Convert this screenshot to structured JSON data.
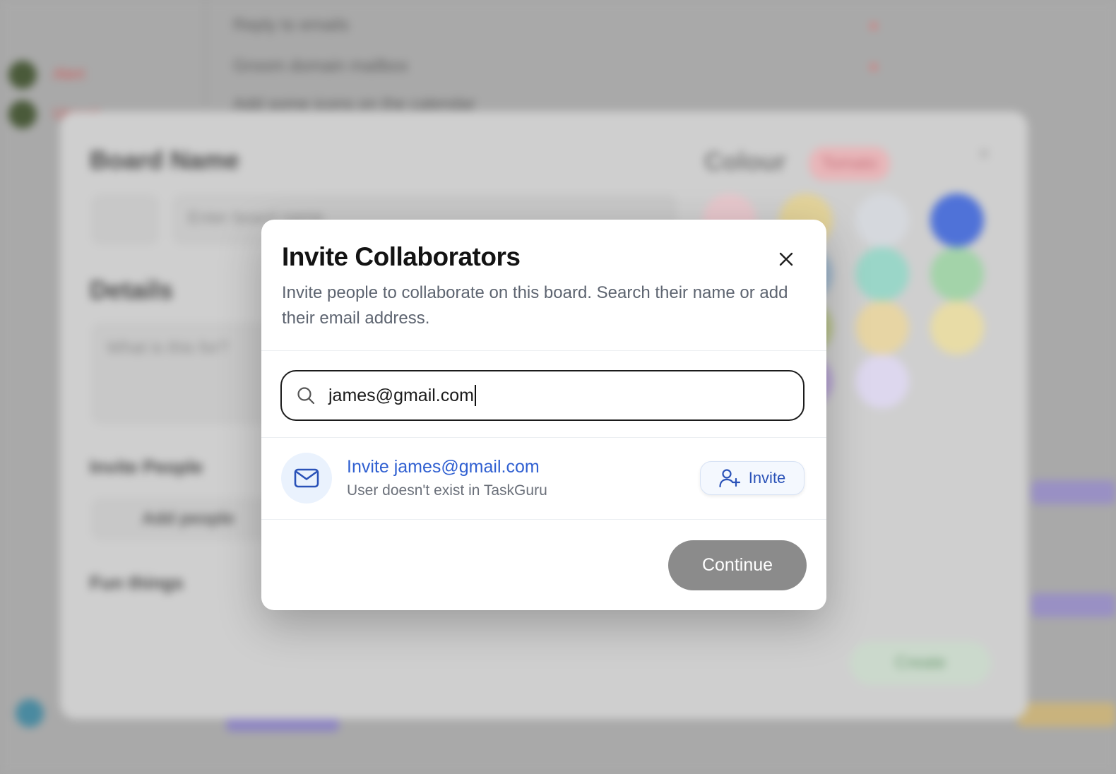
{
  "dialog": {
    "title": "Invite Collaborators",
    "description": "Invite people to collaborate on this board. Search their name or add their email address.",
    "search": {
      "value": "james@gmail.com"
    },
    "result": {
      "title": "Invite james@gmail.com",
      "subtitle": "User doesn't exist in TaskGuru",
      "invite_label": "Invite"
    },
    "continue_label": "Continue"
  },
  "background": {
    "rows": [
      "Reply to emails",
      "Groom domain mailbox",
      "Add some icons on the calendar"
    ],
    "sidebar_labels": [
      "Alert",
      "Urgent"
    ],
    "modal": {
      "board_name_label": "Board Name",
      "board_name_placeholder": "Enter board name",
      "colour_label": "Colour",
      "colour_badge": "Tomato",
      "details_label": "Details",
      "details_placeholder": "What is this for?",
      "invite_people_label": "Invite People",
      "add_people_label": "Add people",
      "fun_things_label": "Fun things",
      "create_label": "Create"
    },
    "swatch_colors": [
      "#e6c7cc",
      "#e3d39a",
      "#d5d8dd",
      "#4f72d8",
      "#9fb8cf",
      "#9ad6c8",
      "#a3d3a9",
      "#b9c48a",
      "#e7d5a4",
      "#e8dca6",
      "#b7a3d6",
      "#ddd7ee"
    ]
  },
  "colors": {
    "accent": "#2f5fd1",
    "continue_disabled": "#8b8b8b",
    "title": "#131313"
  }
}
